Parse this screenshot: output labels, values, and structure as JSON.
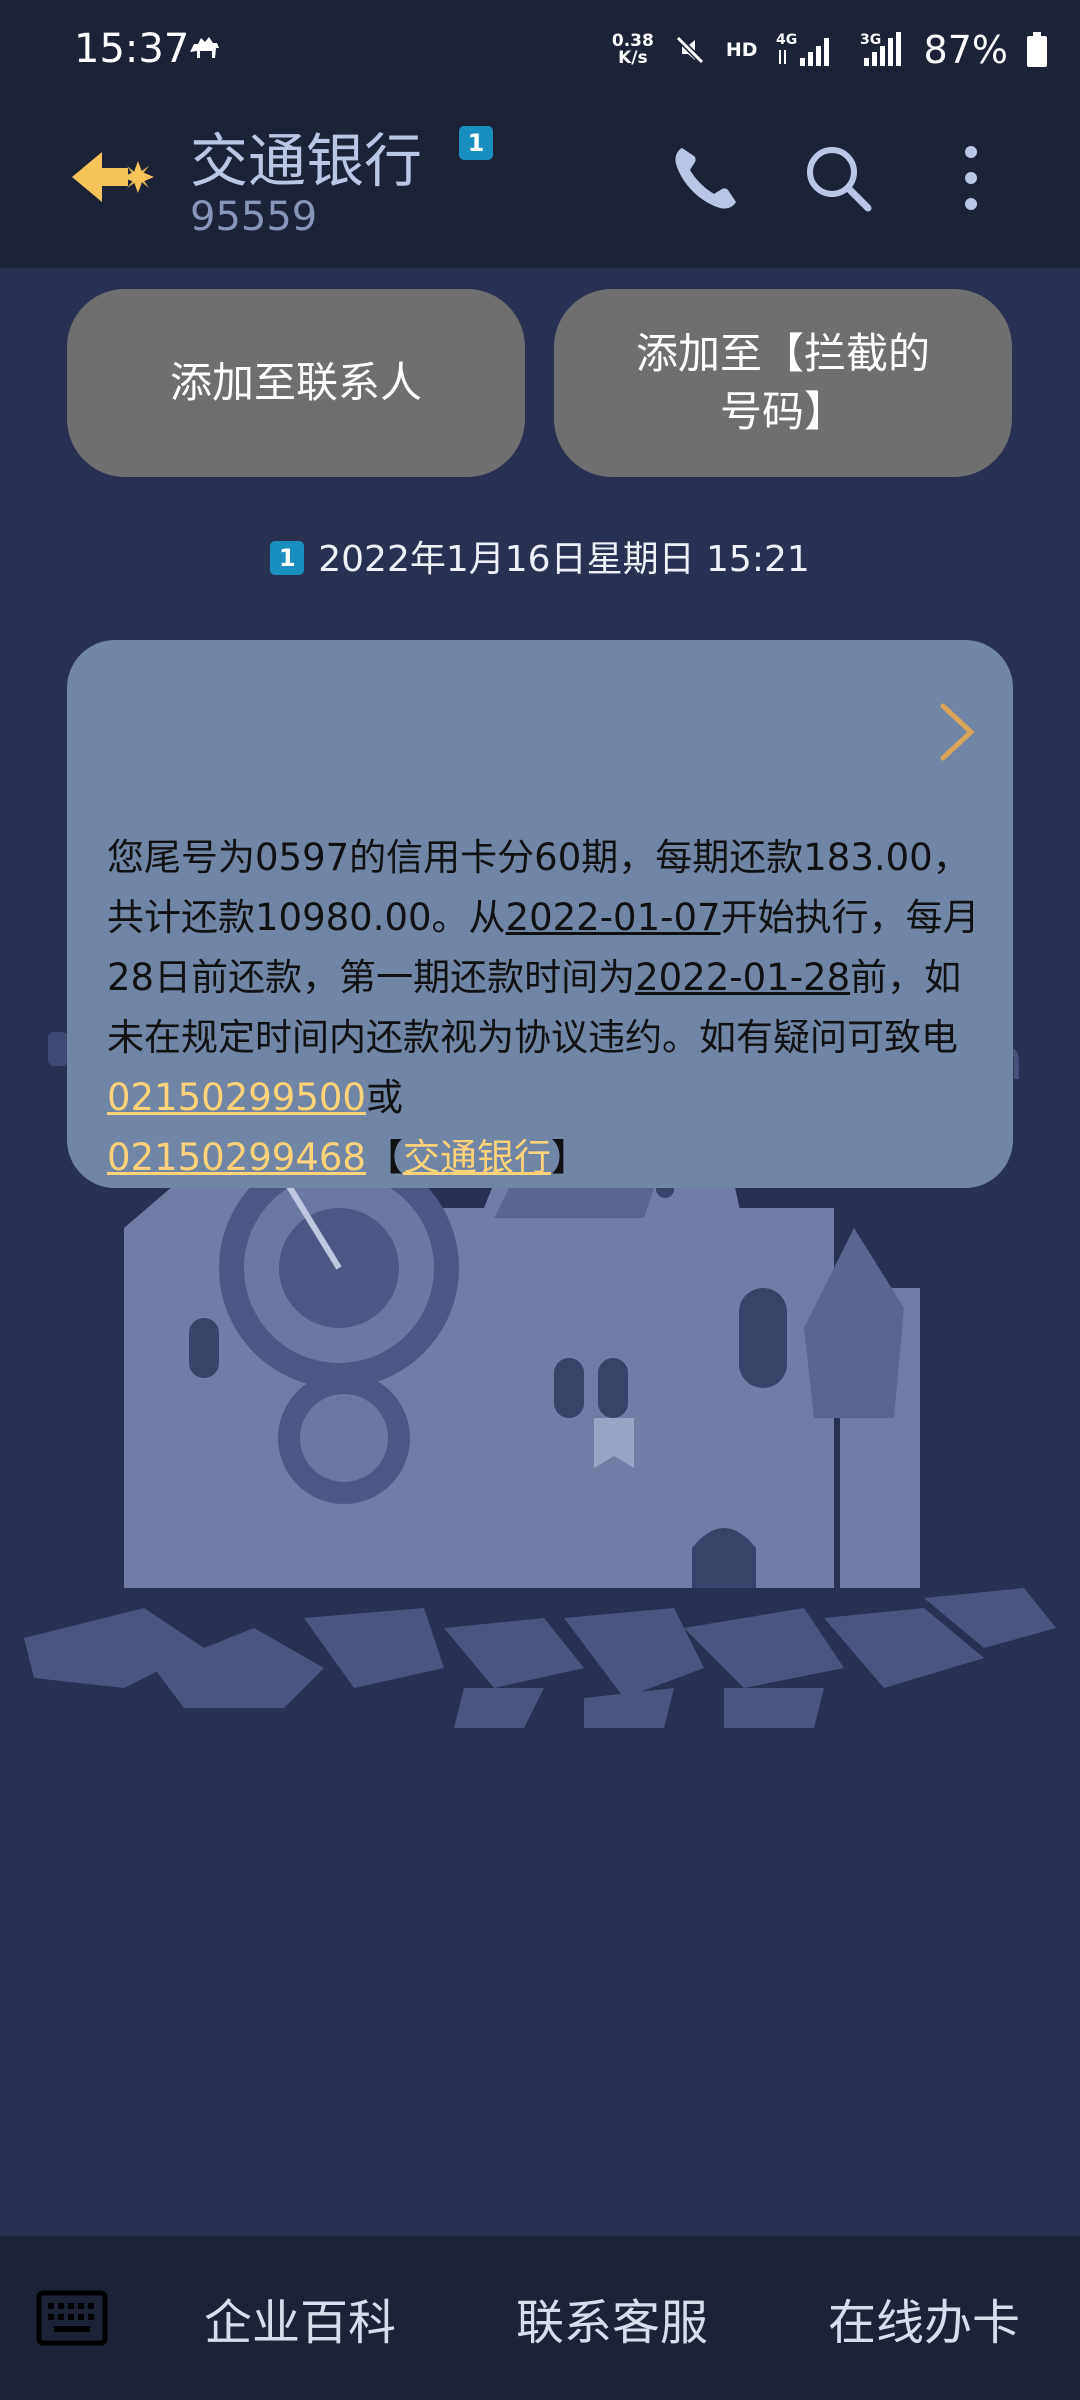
{
  "status_bar": {
    "time": "15:37",
    "net_speed_value": "0.38",
    "net_speed_unit": "K/s",
    "hd_label": "HD",
    "net_4g": "4G",
    "net_3g": "3G",
    "battery": "87%"
  },
  "header": {
    "title": "交通银行",
    "sim_badge": "1",
    "number": "95559"
  },
  "actions": {
    "add_contact": "添加至联系人",
    "add_block_line1": "添加至【拦截的",
    "add_block_line2": "号码】"
  },
  "thread": {
    "sim_badge": "1",
    "timestamp": "2022年1月16日星期日 15:21"
  },
  "message": {
    "part1": "您尾号为0597的信用卡分60期，每期还款183.00，共计还款10980.00。从",
    "date1": "2022-01-07",
    "part2": "开始执行，每月28日前还款，第一期还款时间为",
    "date2": "2022-01-28",
    "part3": "前，如未在规定时间内还款视为协议违约。如有疑问可致电",
    "phone1": "02150299500",
    "part4": "或",
    "phone2": "02150299468",
    "bracket_open": "【",
    "bank_link": "交通银行",
    "bracket_close": "】"
  },
  "bottom_menu": {
    "item1": "企业百科",
    "item2": "联系客服",
    "item3": "在线办卡"
  },
  "colors": {
    "background": "#283151",
    "bar": "#1c2337",
    "bubble": "#7185a4",
    "button": "#6f6f6f",
    "link": "#ffd37a",
    "accent_back": "#f7c35b",
    "sim_badge": "#1a8fbf"
  }
}
